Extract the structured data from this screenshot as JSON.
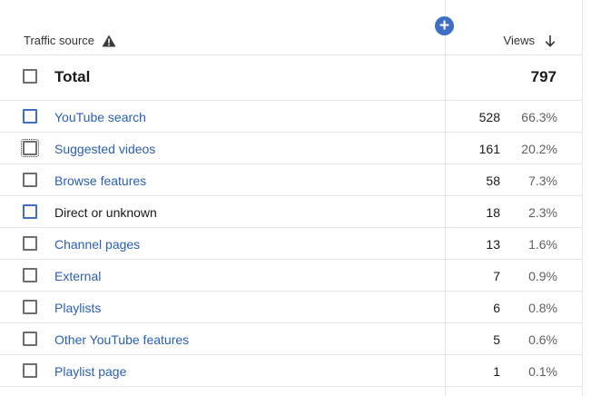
{
  "header": {
    "traffic_source_label": "Traffic source",
    "views_label": "Views",
    "add_button_symbol": "+",
    "warning_icon": "warning-icon",
    "sort_icon": "arrow-down-icon"
  },
  "total": {
    "label": "Total",
    "value": "797"
  },
  "colors": {
    "link": "#2a5fb5",
    "accent": "#3e6fc4"
  },
  "rows": [
    {
      "name": "YouTube search",
      "views": "528",
      "pct": "66.3%"
    },
    {
      "name": "Suggested videos",
      "views": "161",
      "pct": "20.2%"
    },
    {
      "name": "Browse features",
      "views": "58",
      "pct": "7.3%"
    },
    {
      "name": "Direct or unknown",
      "views": "18",
      "pct": "2.3%"
    },
    {
      "name": "Channel pages",
      "views": "13",
      "pct": "1.6%"
    },
    {
      "name": "External",
      "views": "7",
      "pct": "0.9%"
    },
    {
      "name": "Playlists",
      "views": "6",
      "pct": "0.8%"
    },
    {
      "name": "Other YouTube features",
      "views": "5",
      "pct": "0.6%"
    },
    {
      "name": "Playlist page",
      "views": "1",
      "pct": "0.1%"
    }
  ]
}
